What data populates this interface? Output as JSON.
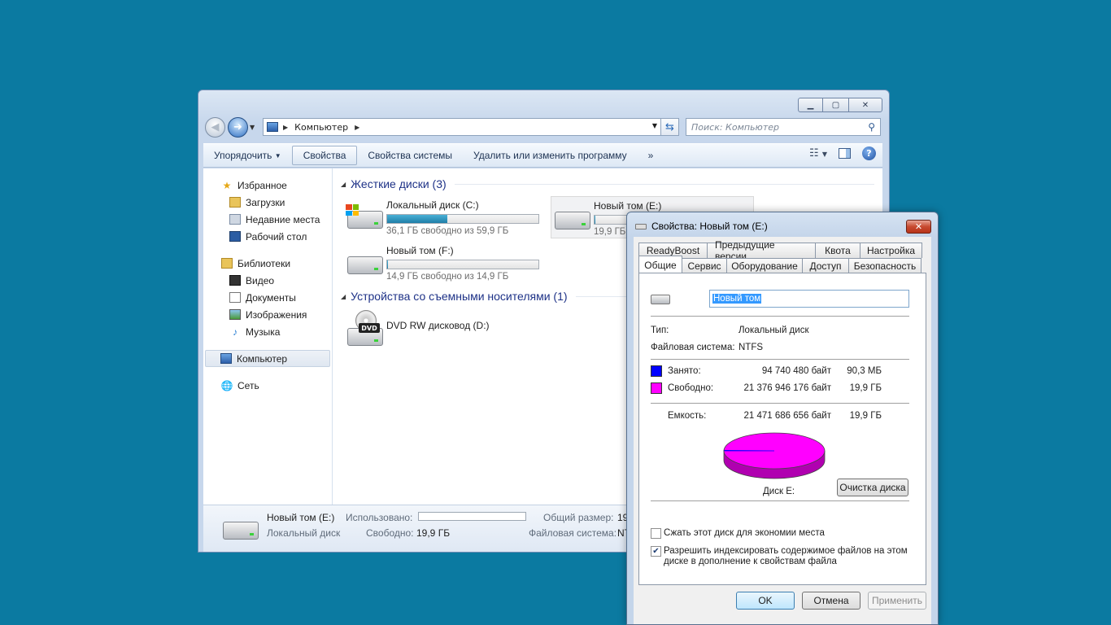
{
  "explorer": {
    "address": {
      "location": "Компьютер"
    },
    "search": {
      "placeholder": "Поиск: Компьютер"
    },
    "toolbar": {
      "organize": "Упорядочить",
      "properties": "Свойства",
      "system_properties": "Свойства системы",
      "uninstall": "Удалить или изменить программу",
      "more": "»"
    },
    "nav": {
      "favorites": "Избранное",
      "downloads": "Загрузки",
      "recent": "Недавние места",
      "desktop": "Рабочий стол",
      "libraries": "Библиотеки",
      "video": "Видео",
      "documents": "Документы",
      "pictures": "Изображения",
      "music": "Музыка",
      "computer": "Компьютер",
      "network": "Сеть"
    },
    "groups": {
      "hard_disks": "Жесткие диски (3)",
      "removable": "Устройства со съемными носителями (1)"
    },
    "drives": [
      {
        "name": "Локальный диск (C:)",
        "free_text": "36,1 ГБ свободно из 59,9 ГБ",
        "used_fraction": 0.397
      },
      {
        "name": "Новый том (E:)",
        "free_text": "19,9 ГБ",
        "used_fraction": 0.004
      },
      {
        "name": "Новый том (F:)",
        "free_text": "14,9 ГБ свободно из 14,9 ГБ",
        "used_fraction": 0.004
      }
    ],
    "dvd": {
      "name": "DVD RW дисковод (D:)",
      "badge": "DVD"
    },
    "details": {
      "name": "Новый том (E:)",
      "type": "Локальный диск",
      "used_label": "Использовано:",
      "free_label": "Свободно:",
      "free_value": "19,9 ГБ",
      "total_label": "Общий размер:",
      "total_value": "19",
      "fs_label": "Файловая система:",
      "fs_value": "NT"
    }
  },
  "dialog": {
    "title": "Свойства: Новый том (E:)",
    "tabs_back": [
      "ReadyBoost",
      "Предыдущие версии",
      "Квота",
      "Настройка"
    ],
    "tabs_front": [
      "Общие",
      "Сервис",
      "Оборудование",
      "Доступ",
      "Безопасность"
    ],
    "volume_name": "Новый том",
    "type_label": "Тип:",
    "type_value": "Локальный диск",
    "fs_label": "Файловая система:",
    "fs_value": "NTFS",
    "used_label": "Занято:",
    "used_bytes": "94 740 480 байт",
    "used_size": "90,3 МБ",
    "free_label": "Свободно:",
    "free_bytes": "21 376 946 176 байт",
    "free_size": "19,9 ГБ",
    "capacity_label": "Емкость:",
    "capacity_bytes": "21 471 686 656 байт",
    "capacity_size": "19,9 ГБ",
    "disk_label": "Диск E:",
    "cleanup_button": "Очистка диска",
    "compress_label": "Сжать этот диск для экономии места",
    "index_label_1": "Разрешить индексировать содержимое файлов на этом",
    "index_label_2": "диске в дополнение к свойствам файла",
    "ok": "OK",
    "cancel": "Отмена",
    "apply": "Применить",
    "used_fraction": 0.0044,
    "colors": {
      "used": "#0000ff",
      "free": "#ff00ff"
    }
  }
}
